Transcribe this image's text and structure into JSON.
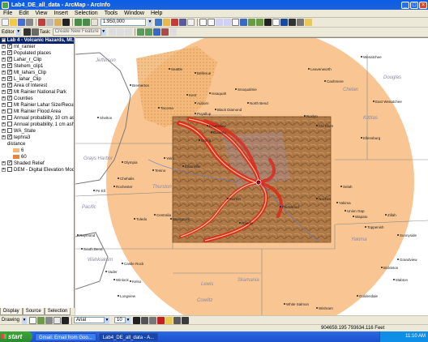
{
  "window": {
    "title": "Lab4_DE_all_data - ArcMap - ArcInfo",
    "controls": [
      "_",
      "□",
      "×"
    ]
  },
  "menu": [
    "File",
    "Edit",
    "View",
    "Insert",
    "Selection",
    "Tools",
    "Window",
    "Help"
  ],
  "toolbar": {
    "scale": "1:950,000",
    "editor_label": "Editor",
    "task_placeholder": "Create New Feature"
  },
  "toc": {
    "data_frame": "Lab 4 - Volcanic Hazards, Mt.",
    "layers": [
      {
        "name": "mt_rainier",
        "checked": true,
        "level": 1
      },
      {
        "name": "Populated places",
        "checked": true,
        "level": 1
      },
      {
        "name": "Lahar_r_Clip",
        "checked": true,
        "level": 1
      },
      {
        "name": "Stehem_clip1",
        "checked": true,
        "level": 1
      },
      {
        "name": "Mt_lahars_Clip",
        "checked": true,
        "level": 1
      },
      {
        "name": "L_lahar_Clip",
        "checked": true,
        "level": 1
      },
      {
        "name": "Area of Interest",
        "checked": true,
        "level": 1
      },
      {
        "name": "Mt Rainier National Park",
        "checked": true,
        "level": 1
      },
      {
        "name": "Counties",
        "checked": true,
        "level": 1
      },
      {
        "name": "Mt Rainier Lahar Size/Recurrer",
        "checked": false,
        "level": 1
      },
      {
        "name": "Mt Rainier Flood Area",
        "checked": false,
        "level": 1
      },
      {
        "name": "Annual probability, 10 cm ash",
        "checked": false,
        "level": 1
      },
      {
        "name": "Annual probability, 1 cm ash",
        "checked": false,
        "level": 1
      },
      {
        "name": "WA_State",
        "checked": false,
        "level": 1
      },
      {
        "name": "tephra3",
        "checked": true,
        "level": 1
      },
      {
        "name": "distance",
        "checked": null,
        "level": 2
      },
      {
        "name": "6",
        "checked": null,
        "level": 3,
        "swatch": "#f5b87a"
      },
      {
        "name": "60",
        "checked": null,
        "level": 3,
        "swatch": "#e6823c"
      },
      {
        "name": "Shaded Relief",
        "checked": true,
        "level": 1
      },
      {
        "name": "DEM - Digital Elevation Model",
        "checked": false,
        "level": 1
      }
    ],
    "tabs": [
      "Display",
      "Source",
      "Selection"
    ]
  },
  "map": {
    "colors": {
      "ash_zone": "#f7c08a",
      "lahar": "#e0241a",
      "relief": "#b07a48",
      "urban": "#e9a565"
    },
    "places": [
      {
        "name": "Jefferson",
        "style": "county"
      },
      {
        "name": "Chelan",
        "style": "county"
      },
      {
        "name": "Douglas",
        "style": "county"
      },
      {
        "name": "Kittitas",
        "style": "county"
      },
      {
        "name": "Grays Harbor",
        "style": "county"
      },
      {
        "name": "Thurston",
        "style": "county"
      },
      {
        "name": "Pacific",
        "style": "county"
      },
      {
        "name": "Wahkiakum",
        "style": "county"
      },
      {
        "name": "Lewis",
        "style": "county"
      },
      {
        "name": "Yakima",
        "style": "county"
      },
      {
        "name": "Cowlitz",
        "style": "county"
      },
      {
        "name": "Skamania",
        "style": "county"
      },
      {
        "name": "Seattle",
        "style": "city"
      },
      {
        "name": "Bellevue",
        "style": "city"
      },
      {
        "name": "Tacoma",
        "style": "city"
      },
      {
        "name": "Olympia",
        "style": "city"
      },
      {
        "name": "Chehalis",
        "style": "city"
      },
      {
        "name": "Centralia",
        "style": "city"
      },
      {
        "name": "Kent",
        "style": "city"
      },
      {
        "name": "Auburn",
        "style": "city"
      },
      {
        "name": "Puyallup",
        "style": "city"
      },
      {
        "name": "Enumclaw",
        "style": "city"
      },
      {
        "name": "Eatonville",
        "style": "city"
      },
      {
        "name": "Morton",
        "style": "city"
      },
      {
        "name": "Packwood",
        "style": "city"
      },
      {
        "name": "Randle",
        "style": "city"
      },
      {
        "name": "Mossyrock",
        "style": "city"
      },
      {
        "name": "Toledo",
        "style": "city"
      },
      {
        "name": "Castle Rock",
        "style": "city"
      },
      {
        "name": "Kelso",
        "style": "city"
      },
      {
        "name": "Longview",
        "style": "city"
      },
      {
        "name": "Rochester",
        "style": "city"
      },
      {
        "name": "Tenino",
        "style": "city"
      },
      {
        "name": "Yelm",
        "style": "city"
      },
      {
        "name": "Shelton",
        "style": "city"
      },
      {
        "name": "Bremerton",
        "style": "city"
      },
      {
        "name": "Issaquah",
        "style": "city"
      },
      {
        "name": "Snoqualmie",
        "style": "city"
      },
      {
        "name": "North Bend",
        "style": "city"
      },
      {
        "name": "Cle Elum",
        "style": "city"
      },
      {
        "name": "Roslyn",
        "style": "city"
      },
      {
        "name": "Ellensburg",
        "style": "city"
      },
      {
        "name": "Naches",
        "style": "city"
      },
      {
        "name": "Selah",
        "style": "city"
      },
      {
        "name": "Yakima",
        "style": "city"
      },
      {
        "name": "Union Gap",
        "style": "city"
      },
      {
        "name": "Wapato",
        "style": "city"
      },
      {
        "name": "Toppenish",
        "style": "city"
      },
      {
        "name": "Zillah",
        "style": "city"
      },
      {
        "name": "Sunnyside",
        "style": "city"
      },
      {
        "name": "Wenatchee",
        "style": "city"
      },
      {
        "name": "East Wenatchee",
        "style": "city"
      },
      {
        "name": "Leavenworth",
        "style": "city"
      },
      {
        "name": "Cashmere",
        "style": "city"
      },
      {
        "name": "Raymond",
        "style": "city"
      },
      {
        "name": "South Bend",
        "style": "city"
      },
      {
        "name": "Pe Ell",
        "style": "city"
      },
      {
        "name": "Vader",
        "style": "city"
      },
      {
        "name": "Winlock",
        "style": "city"
      },
      {
        "name": "White Salmon",
        "style": "city"
      },
      {
        "name": "Goldendale",
        "style": "city"
      },
      {
        "name": "Wishram",
        "style": "city"
      },
      {
        "name": "Bickleton",
        "style": "city"
      },
      {
        "name": "Mabton",
        "style": "city"
      },
      {
        "name": "Grandview",
        "style": "city"
      },
      {
        "name": "Buckley",
        "style": "city"
      },
      {
        "name": "Orting",
        "style": "city"
      },
      {
        "name": "Black Diamond",
        "style": "city"
      }
    ]
  },
  "drawing": {
    "label": "Drawing",
    "font": "Arial",
    "size": "10"
  },
  "status": {
    "coords": "904659.195  793634.116 Feet"
  },
  "taskbar": {
    "start": "start",
    "items": [
      "Gmail: Email from Goo...",
      "Lab4_DE_all_data - A..."
    ],
    "clock": "11:10 AM"
  }
}
